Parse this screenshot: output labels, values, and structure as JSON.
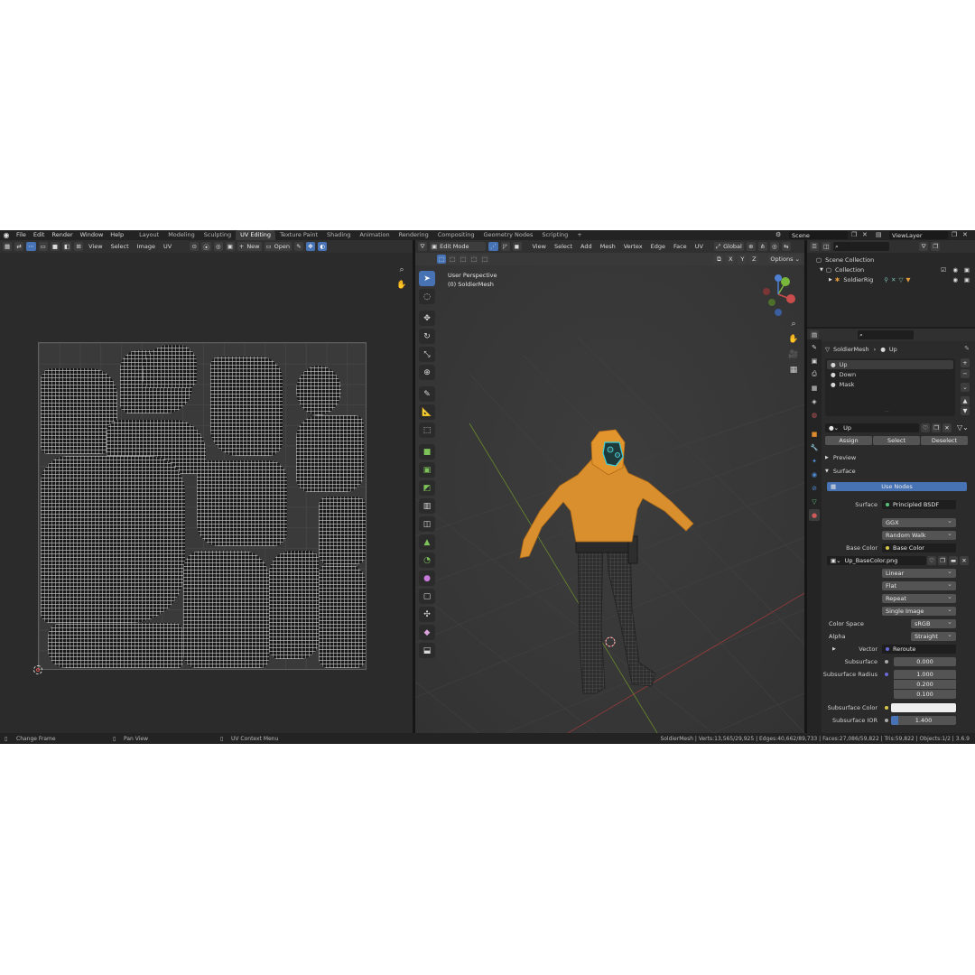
{
  "topbar": {
    "menus": [
      "File",
      "Edit",
      "Render",
      "Window",
      "Help"
    ],
    "workspaces": [
      "Layout",
      "Modeling",
      "Sculpting",
      "UV Editing",
      "Texture Paint",
      "Shading",
      "Animation",
      "Rendering",
      "Compositing",
      "Geometry Nodes",
      "Scripting"
    ],
    "active_workspace": "UV Editing",
    "add_tab": "+",
    "scene": "Scene",
    "view_layer": "ViewLayer"
  },
  "uv_editor": {
    "menus": [
      "View",
      "Select",
      "Image",
      "UV"
    ],
    "new_label": "New",
    "open_label": "Open"
  },
  "viewport": {
    "mode": "Edit Mode",
    "menus": [
      "View",
      "Select",
      "Add",
      "Mesh",
      "Vertex",
      "Edge",
      "Face",
      "UV"
    ],
    "transform_orientation": "Global",
    "axis_x": "X",
    "axis_y": "Y",
    "axis_z": "Z",
    "options_label": "Options",
    "info_line1": "User Perspective",
    "info_line2": "(0) SoldierMesh"
  },
  "outliner": {
    "root": "Scene Collection",
    "collection": "Collection",
    "object": "SoldierRig"
  },
  "properties": {
    "breadcrumb_object": "SoldierMesh",
    "breadcrumb_material": "Up",
    "material_slots": [
      "Up",
      "Down",
      "Mask"
    ],
    "active_material": "Up",
    "assign_label": "Assign",
    "select_label": "Select",
    "deselect_label": "Deselect",
    "preview_panel": "Preview",
    "surface_panel": "Surface",
    "use_nodes_label": "Use Nodes",
    "surface_label": "Surface",
    "surface_value": "Principled BSDF",
    "distribution": "GGX",
    "subsurface_method": "Random Walk",
    "base_color_label": "Base Color",
    "base_color_value": "Base Color",
    "image_name": "Up_BaseColor.png",
    "interpolation": "Linear",
    "projection": "Flat",
    "extension": "Repeat",
    "source": "Single Image",
    "color_space_label": "Color Space",
    "color_space_value": "sRGB",
    "alpha_label": "Alpha",
    "alpha_value": "Straight",
    "vector_label": "Vector",
    "vector_value": "Reroute",
    "subsurface_label": "Subsurface",
    "subsurface_value": "0.000",
    "subsurface_radius_label": "Subsurface Radius",
    "subsurface_radius": [
      "1.000",
      "0.200",
      "0.100"
    ],
    "subsurface_color_label": "Subsurface Color",
    "subsurface_ior_label": "Subsurface IOR",
    "subsurface_ior_value": "1.400",
    "accent_color": "#4772b3"
  },
  "statusbar": {
    "left1": "Change Frame",
    "left2": "Pan View",
    "left3": "UV Context Menu",
    "stats": "SoldierMesh | Verts:13,565/29,925 | Edges:40,662/89,733 | Faces:27,086/59,822 | Tris:59,822 | Objects:1/2 | 3.6.9"
  }
}
